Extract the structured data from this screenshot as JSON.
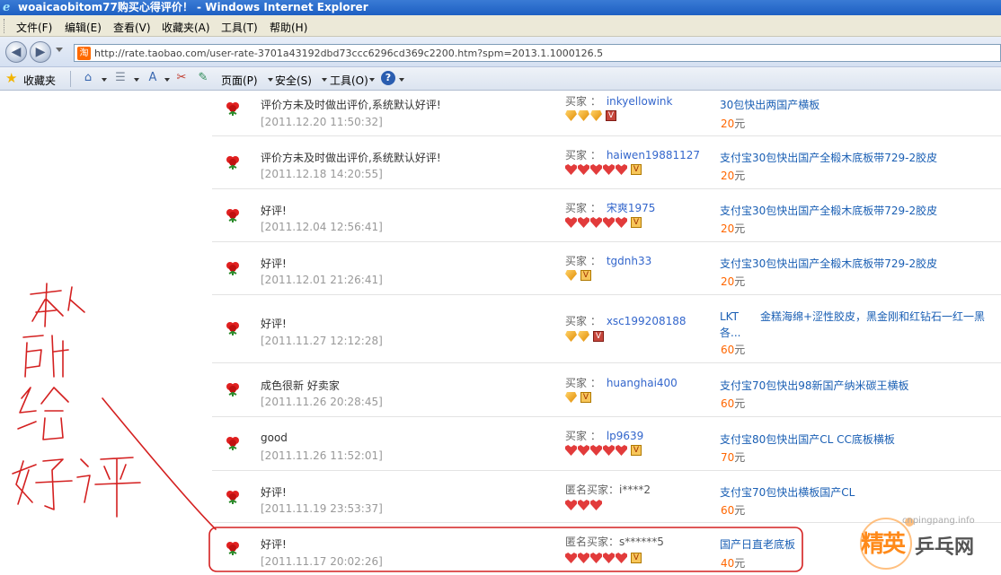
{
  "window": {
    "title": "woaicaobitom77购买心得评价！ - Windows Internet Explorer"
  },
  "menubar": {
    "items": [
      "文件(F)",
      "编辑(E)",
      "查看(V)",
      "收藏夹(A)",
      "工具(T)",
      "帮助(H)"
    ]
  },
  "address": {
    "url": "http://rate.taobao.com/user-rate-3701a43192dbd73ccc6296cd369c2200.htm?spm=2013.1.1000126.5",
    "favicon_text": "淘"
  },
  "commandbar": {
    "favorites_label": "收藏夹",
    "page_label": "页面(P)",
    "safety_label": "安全(S)",
    "tools_label": "工具(O)"
  },
  "rows": [
    {
      "comment": "评价方未及时做出评价,系统默认好评!",
      "date": "[2011.12.20 11:50:32]",
      "buyer_label": "买家 ：",
      "buyer": "inkyellowink",
      "item": "30包快出两国产横板",
      "item2": "",
      "price": "20",
      "unit": "元",
      "badges": [
        "diamond",
        "diamond",
        "diamond"
      ],
      "vip": "red"
    },
    {
      "comment": "评价方未及时做出评价,系统默认好评!",
      "date": "[2011.12.18 14:20:55]",
      "buyer_label": "买家 ：",
      "buyer": "haiwen19881127",
      "item": "支付宝30包快出国产全椴木底板带729-2胶皮",
      "item2": "",
      "price": "20",
      "unit": "元",
      "badges": [
        "heart",
        "heart",
        "heart",
        "heart",
        "heart"
      ],
      "vip": "gold"
    },
    {
      "comment": "好评!",
      "date": "[2011.12.04 12:56:41]",
      "buyer_label": "买家 ：",
      "buyer": "宋爽1975",
      "item": "支付宝30包快出国产全椴木底板带729-2胶皮",
      "item2": "",
      "price": "20",
      "unit": "元",
      "badges": [
        "heart",
        "heart",
        "heart",
        "heart",
        "heart"
      ],
      "vip": "gold"
    },
    {
      "comment": "好评!",
      "date": "[2011.12.01 21:26:41]",
      "buyer_label": "买家 ：",
      "buyer": "tgdnh33",
      "item": "支付宝30包快出国产全椴木底板带729-2胶皮",
      "item2": "",
      "price": "20",
      "unit": "元",
      "badges": [
        "diamond"
      ],
      "vip": "gold"
    },
    {
      "comment": "好评!",
      "date": "[2011.11.27 12:12:28]",
      "buyer_label": "买家 ：",
      "buyer": "xsc199208188",
      "item": "LKT　　金糕海绵+涩性胶皮，黑金刚和红钻石一红一黑",
      "item2": "各...",
      "price": "60",
      "unit": "元",
      "badges": [
        "diamond",
        "diamond"
      ],
      "vip": "red"
    },
    {
      "comment": "成色很新 好卖家",
      "date": "[2011.11.26 20:28:45]",
      "buyer_label": "买家 ：",
      "buyer": "huanghai400",
      "item": "支付宝70包快出98新国产纳米碳王横板",
      "item2": "",
      "price": "60",
      "unit": "元",
      "badges": [
        "diamond"
      ],
      "vip": "gold"
    },
    {
      "comment": "good",
      "date": "[2011.11.26 11:52:01]",
      "buyer_label": "买家 ：",
      "buyer": "lp9639",
      "item": "支付宝80包快出国产CL CC底板横板",
      "item2": "",
      "price": "70",
      "unit": "元",
      "badges": [
        "heart",
        "heart",
        "heart",
        "heart",
        "heart"
      ],
      "vip": "gold"
    },
    {
      "comment": "好评!",
      "date": "[2011.11.19 23:53:37]",
      "buyer_label": "匿名买家：",
      "buyer": "i****2",
      "item": "支付宝70包快出横板国产CL",
      "item2": "",
      "price": "60",
      "unit": "元",
      "badges": [
        "heart",
        "heart",
        "heart"
      ],
      "vip": ""
    },
    {
      "comment": "好评!",
      "date": "[2011.11.17 20:02:26]",
      "buyer_label": "匿名买家：",
      "buyer": "s******5",
      "item": "国产日直老底板",
      "item2": "",
      "price": "40",
      "unit": "元",
      "badges": [
        "heart",
        "heart",
        "heart",
        "heart",
        "heart"
      ],
      "vip": "gold"
    }
  ],
  "annotation": {
    "handwritten_text": "本人所给好评"
  },
  "watermark": {
    "site": "cnpingpang.info",
    "brand_left": "精英",
    "brand_right": "乒乓网"
  },
  "colors": {
    "link": "#1a5fb4",
    "price": "#ff6600",
    "annotation_red": "#d42020"
  }
}
